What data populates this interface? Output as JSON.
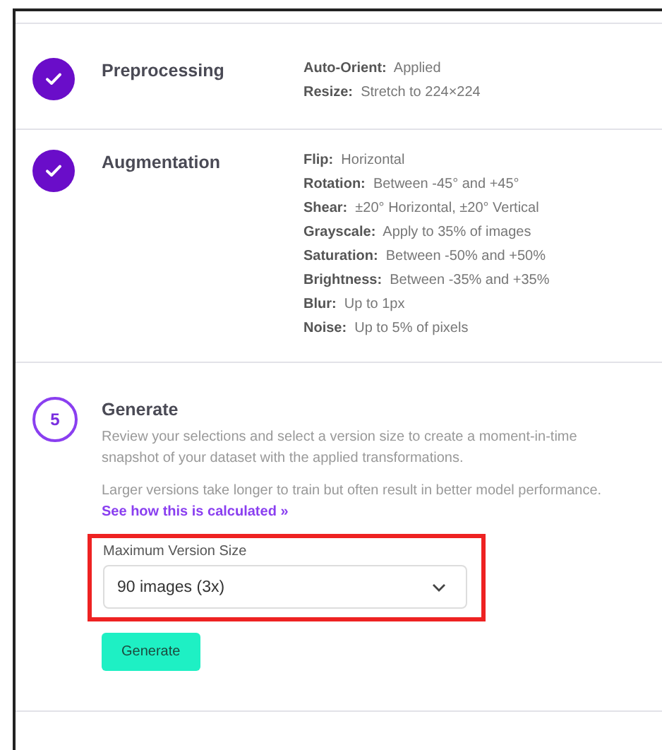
{
  "steps": [
    {
      "kind": "done",
      "title": "Preprocessing",
      "details": [
        {
          "label": "Auto-Orient:",
          "value": "Applied"
        },
        {
          "label": "Resize:",
          "value": "Stretch to 224×224"
        }
      ]
    },
    {
      "kind": "done",
      "title": "Augmentation",
      "details": [
        {
          "label": "Flip:",
          "value": "Horizontal"
        },
        {
          "label": "Rotation:",
          "value": "Between -45° and +45°"
        },
        {
          "label": "Shear:",
          "value": "±20° Horizontal, ±20° Vertical"
        },
        {
          "label": "Grayscale:",
          "value": "Apply to 35% of images"
        },
        {
          "label": "Saturation:",
          "value": "Between -50% and +50%"
        },
        {
          "label": "Brightness:",
          "value": "Between -35% and +35%"
        },
        {
          "label": "Blur:",
          "value": "Up to 1px"
        },
        {
          "label": "Noise:",
          "value": "Up to 5% of pixels"
        }
      ]
    },
    {
      "kind": "number",
      "number": "5",
      "title": "Generate",
      "description": "Review your selections and select a version size to create a moment-in-time snapshot of your dataset with the applied transformations.",
      "note": "Larger versions take longer to train but often result in better model performance.",
      "link": "See how this is calculated »",
      "field": {
        "label": "Maximum Version Size",
        "value": "90 images (3x)",
        "highlighted": true
      },
      "button": "Generate"
    }
  ]
}
